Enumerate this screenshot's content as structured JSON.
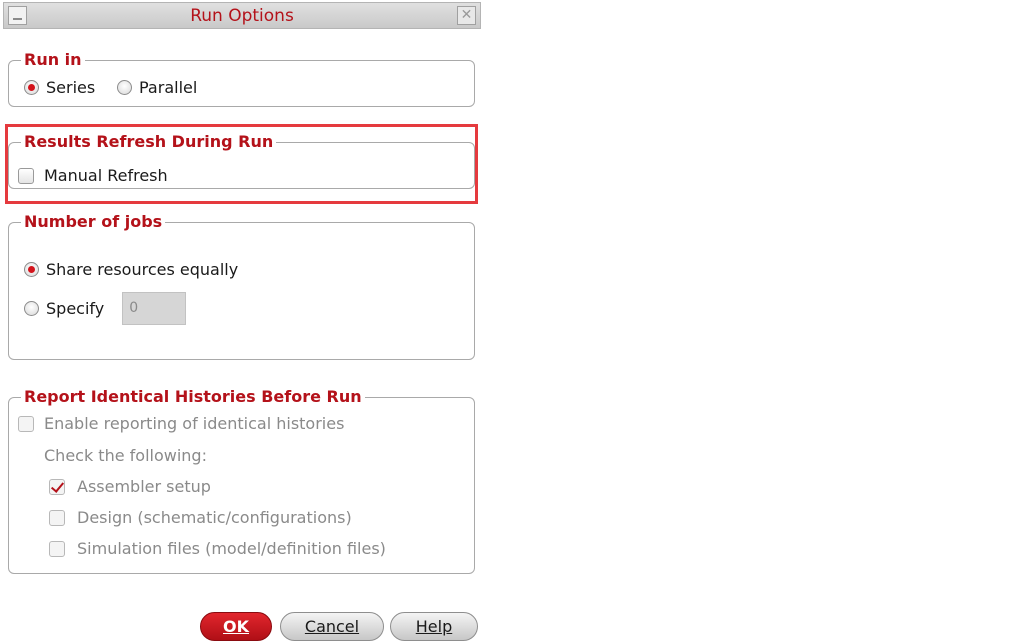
{
  "window": {
    "title": "Run Options"
  },
  "run_in": {
    "legend": "Run in",
    "options": [
      {
        "label": "Series",
        "selected": true
      },
      {
        "label": "Parallel",
        "selected": false
      }
    ]
  },
  "results_refresh": {
    "legend": "Results Refresh During Run",
    "manual_refresh_label": "Manual Refresh",
    "manual_refresh_checked": false
  },
  "number_of_jobs": {
    "legend": "Number of jobs",
    "share_label": "Share resources equally",
    "share_selected": true,
    "specify_label": "Specify",
    "specify_selected": false,
    "specify_value": "0"
  },
  "report_histories": {
    "legend": "Report Identical Histories Before Run",
    "enable_label": "Enable reporting of identical histories",
    "check_following_label": "Check the following:",
    "items": [
      {
        "label": "Assembler setup",
        "checked": true
      },
      {
        "label": "Design  (schematic/configurations)",
        "checked": false
      },
      {
        "label": "Simulation files  (model/definition files)",
        "checked": false
      }
    ]
  },
  "buttons": {
    "ok": "OK",
    "cancel": "Cancel",
    "help": "Help"
  },
  "colors": {
    "accent": "#b4121a",
    "highlight": "#e53a3e"
  }
}
